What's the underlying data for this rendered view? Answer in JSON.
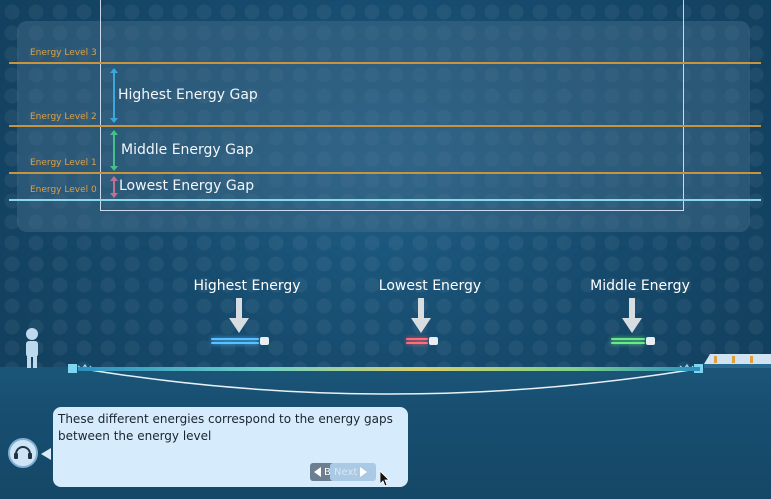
{
  "energy_levels": [
    {
      "label": "Energy Level 3",
      "color": "#d6a045"
    },
    {
      "label": "Energy Level 2",
      "color": "#d6a045"
    },
    {
      "label": "Energy Level 1",
      "color": "#d6a045"
    },
    {
      "label": "Energy Level 0",
      "color": "#8ae0f0"
    }
  ],
  "gaps": [
    {
      "label": "Highest Energy Gap",
      "color": "#3aa7e0"
    },
    {
      "label": "Middle Energy Gap",
      "color": "#45c08a"
    },
    {
      "label": "Lowest Energy Gap",
      "color": "#c07090"
    }
  ],
  "photons": [
    {
      "label": "Highest Energy",
      "color": "#4ab8ff"
    },
    {
      "label": "Lowest Energy",
      "color": "#ff5a6a"
    },
    {
      "label": "Middle Energy",
      "color": "#5ee07a"
    }
  ],
  "dialog": {
    "text": "These different energies correspond to the energy gaps between the energy level",
    "back_label": "Back",
    "next_label": "Next"
  },
  "icons": {
    "back": "triangle-left-icon",
    "next": "triangle-right-icon",
    "narrator": "headset-icon",
    "cursor": "arrow-cursor-icon"
  }
}
